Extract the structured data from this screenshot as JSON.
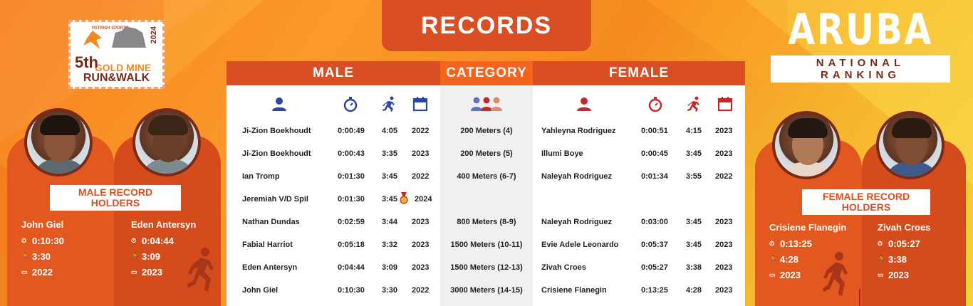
{
  "header": {
    "title": "RECORDS"
  },
  "logo": {
    "brand": "PATRISH SPORTS",
    "edition": "5th",
    "line1": "GOLD MINE",
    "line2": "RUN&WALK",
    "year": "2024"
  },
  "ranking": {
    "country": "ARUBA",
    "subtitle": "NATIONAL RANKING"
  },
  "columns": {
    "male": "MALE",
    "category": "CATEGORY",
    "female": "FEMALE"
  },
  "colors": {
    "primary": "#d94f23",
    "accent": "#f5641c",
    "icon_blue": "#2a46a6",
    "icon_red": "#c4282a"
  },
  "icons": [
    "person-icon",
    "stopwatch-icon",
    "runner-icon",
    "calendar-icon",
    "group-icon"
  ],
  "rows": [
    {
      "male_name": "Ji-Zion Boekhoudt",
      "male_time": "0:00:49",
      "male_pace": "4:05",
      "male_year": "2022",
      "category": "200 Meters (4)",
      "female_name": "Yahleyna Rodriguez",
      "female_time": "0:00:51",
      "female_pace": "4:15",
      "female_year": "2023"
    },
    {
      "male_name": "Ji-Zion Boekhoudt",
      "male_time": "0:00:43",
      "male_pace": "3:35",
      "male_year": "2023",
      "category": "200 Meters (5)",
      "female_name": "Illumi Boye",
      "female_time": "0:00:45",
      "female_pace": "3:45",
      "female_year": "2023"
    },
    {
      "male_name": "Ian Tromp",
      "male_time": "0:01:30",
      "male_pace": "3:45",
      "male_year": "2022",
      "category": "400 Meters (6-7)",
      "female_name": "Naleyah Rodriguez",
      "female_time": "0:01:34",
      "female_pace": "3:55",
      "female_year": "2022"
    },
    {
      "male_name": "Jeremiah V/D Spil",
      "male_time": "0:01:30",
      "male_pace": "3:45",
      "male_year": "2024",
      "category": "",
      "female_name": "",
      "female_time": "",
      "female_pace": "",
      "female_year": ""
    },
    {
      "male_name": "Nathan Dundas",
      "male_time": "0:02:59",
      "male_pace": "3:44",
      "male_year": "2023",
      "category": "800 Meters (8-9)",
      "female_name": "Naleyah Rodriguez",
      "female_time": "0:03:00",
      "female_pace": "3:45",
      "female_year": "2023"
    },
    {
      "male_name": "Fabial Harriot",
      "male_time": "0:05:18",
      "male_pace": "3:32",
      "male_year": "2023",
      "category": "1500 Meters (10-11)",
      "female_name": "Evie Adele Leonardo",
      "female_time": "0:05:37",
      "female_pace": "3:45",
      "female_year": "2023"
    },
    {
      "male_name": "Eden Antersyn",
      "male_time": "0:04:44",
      "male_pace": "3:09",
      "male_year": "2023",
      "category": "1500 Meters (12-13)",
      "female_name": "Zivah Croes",
      "female_time": "0:05:27",
      "female_pace": "3:38",
      "female_year": "2023"
    },
    {
      "male_name": "John Giel",
      "male_time": "0:10:30",
      "male_pace": "3:30",
      "male_year": "2022",
      "category": "3000 Meters (14-15)",
      "female_name": "Crisiene Flanegin",
      "female_time": "0:13:25",
      "female_pace": "4:28",
      "female_year": "2023"
    }
  ],
  "male_holders": {
    "label": "MALE RECORD HOLDERS",
    "people": [
      {
        "name": "John Giel",
        "time": "0:10:30",
        "pace": "3:30",
        "year": "2022"
      },
      {
        "name": "Eden Antersyn",
        "time": "0:04:44",
        "pace": "3:09",
        "year": "2023"
      }
    ]
  },
  "female_holders": {
    "label": "FEMALE RECORD HOLDERS",
    "people": [
      {
        "name": "Crisiene Flanegin",
        "time": "0:13:25",
        "pace": "4:28",
        "year": "2023"
      },
      {
        "name": "Zivah Croes",
        "time": "0:05:27",
        "pace": "3:38",
        "year": "2023"
      }
    ]
  }
}
